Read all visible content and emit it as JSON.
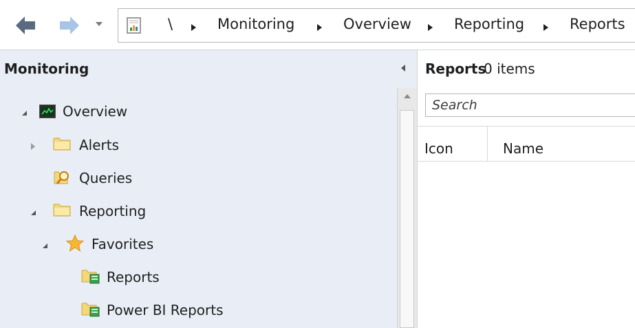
{
  "toolbar": {
    "back_icon": "back-arrow-icon",
    "forward_icon": "forward-arrow-icon",
    "history_icon": "chevron-down-icon",
    "breadcrumb": {
      "root": "\\",
      "items": [
        "Monitoring",
        "Overview",
        "Reporting",
        "Reports"
      ]
    }
  },
  "nav_pane": {
    "title": "Monitoring",
    "items": [
      {
        "label": "Overview",
        "icon": "monitor-chart-icon",
        "state": "expanded"
      },
      {
        "label": "Alerts",
        "icon": "folder-icon",
        "state": "collapsed"
      },
      {
        "label": "Queries",
        "icon": "query-folder-icon",
        "state": "none"
      },
      {
        "label": "Reporting",
        "icon": "folder-icon",
        "state": "expanded"
      },
      {
        "label": "Favorites",
        "icon": "star-icon",
        "state": "expanded"
      },
      {
        "label": "Reports",
        "icon": "report-folder-icon",
        "state": "none"
      },
      {
        "label": "Power BI Reports",
        "icon": "report-folder-icon",
        "state": "none"
      }
    ]
  },
  "content": {
    "title": "Reports",
    "count": "0 items",
    "search": {
      "placeholder": "Search",
      "value": ""
    },
    "columns": [
      "Icon",
      "Name"
    ]
  },
  "colors": {
    "nav_background": "#e9eef6",
    "folder_yellow": "#f3d77a",
    "back_arrow": "#5a6a80",
    "forward_arrow": "#a8c4e6",
    "border": "#aeb6c3"
  }
}
